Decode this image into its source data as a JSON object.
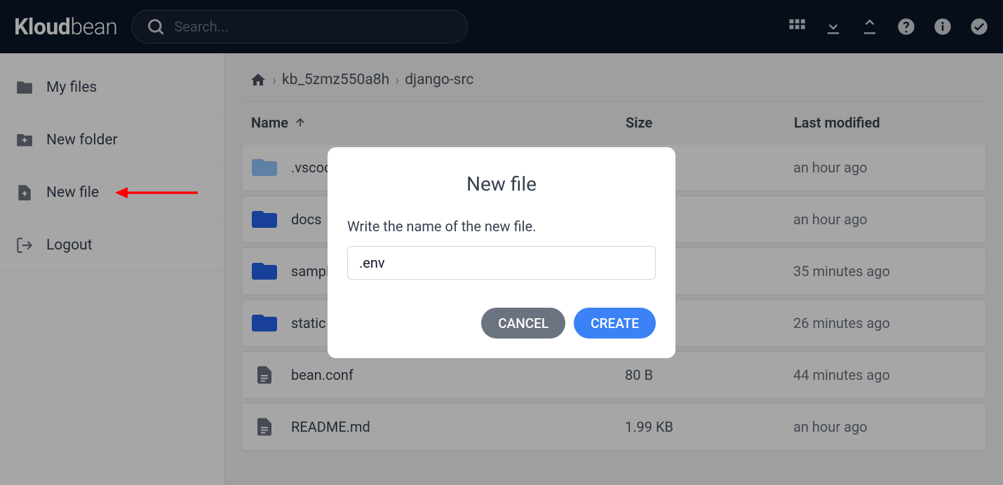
{
  "logo": {
    "first": "Kloud",
    "second": "bean"
  },
  "search": {
    "placeholder": "Search..."
  },
  "sidebar": {
    "items": [
      {
        "label": "My files"
      },
      {
        "label": "New folder"
      },
      {
        "label": "New file"
      },
      {
        "label": "Logout"
      }
    ]
  },
  "breadcrumb": {
    "parts": [
      "kb_5zmz550a8h",
      "django-src"
    ]
  },
  "table": {
    "headers": {
      "name": "Name",
      "size": "Size",
      "modified": "Last modified"
    },
    "rows": [
      {
        "name": ".vscode",
        "size": "",
        "modified": "an hour ago",
        "type": "folder-light"
      },
      {
        "name": "docs",
        "size": "",
        "modified": "an hour ago",
        "type": "folder"
      },
      {
        "name": "sample",
        "size": "",
        "modified": "35 minutes ago",
        "type": "folder"
      },
      {
        "name": "static",
        "size": "",
        "modified": "26 minutes ago",
        "type": "folder"
      },
      {
        "name": "bean.conf",
        "size": "80 B",
        "modified": "44 minutes ago",
        "type": "file"
      },
      {
        "name": "README.md",
        "size": "1.99 KB",
        "modified": "an hour ago",
        "type": "file"
      }
    ]
  },
  "modal": {
    "title": "New file",
    "label": "Write the name of the new file.",
    "value": ".env",
    "cancel": "CANCEL",
    "create": "CREATE"
  }
}
